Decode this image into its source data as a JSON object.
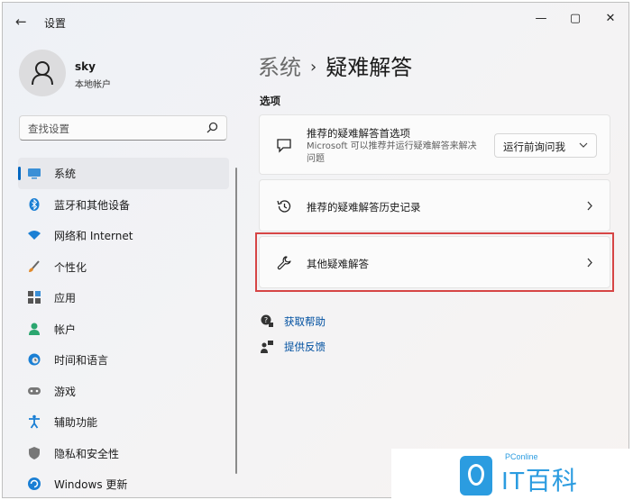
{
  "window": {
    "title": "设置",
    "back_icon": "←",
    "minimize": "—",
    "maximize": "▢",
    "close": "✕"
  },
  "user": {
    "name": "sky",
    "account_type": "本地帐户"
  },
  "search": {
    "placeholder": "查找设置"
  },
  "sidebar": {
    "items": [
      {
        "label": "系统",
        "icon": "system-icon",
        "active": true
      },
      {
        "label": "蓝牙和其他设备",
        "icon": "bluetooth-icon"
      },
      {
        "label": "网络和 Internet",
        "icon": "wifi-icon"
      },
      {
        "label": "个性化",
        "icon": "brush-icon"
      },
      {
        "label": "应用",
        "icon": "apps-icon"
      },
      {
        "label": "帐户",
        "icon": "account-icon"
      },
      {
        "label": "时间和语言",
        "icon": "globe-clock-icon"
      },
      {
        "label": "游戏",
        "icon": "gamepad-icon"
      },
      {
        "label": "辅助功能",
        "icon": "accessibility-icon"
      },
      {
        "label": "隐私和安全性",
        "icon": "shield-icon"
      },
      {
        "label": "Windows 更新",
        "icon": "update-icon"
      }
    ]
  },
  "breadcrumb": {
    "parent": "系统",
    "separator": "›",
    "current": "疑难解答"
  },
  "main": {
    "section_title": "选项",
    "cards": [
      {
        "title": "推荐的疑难解答首选项",
        "description": "Microsoft 可以推荐并运行疑难解答来解决问题",
        "dropdown_value": "运行前询问我"
      },
      {
        "title": "推荐的疑难解答历史记录"
      },
      {
        "title": "其他疑难解答"
      }
    ],
    "links": [
      {
        "label": "获取帮助"
      },
      {
        "label": "提供反馈"
      }
    ]
  },
  "watermark": {
    "small": "PConline",
    "big": "IT百科"
  },
  "colors": {
    "accent": "#0067c0",
    "highlight_border": "#d64545",
    "link": "#0050a0",
    "watermark": "#2b9ce0"
  }
}
